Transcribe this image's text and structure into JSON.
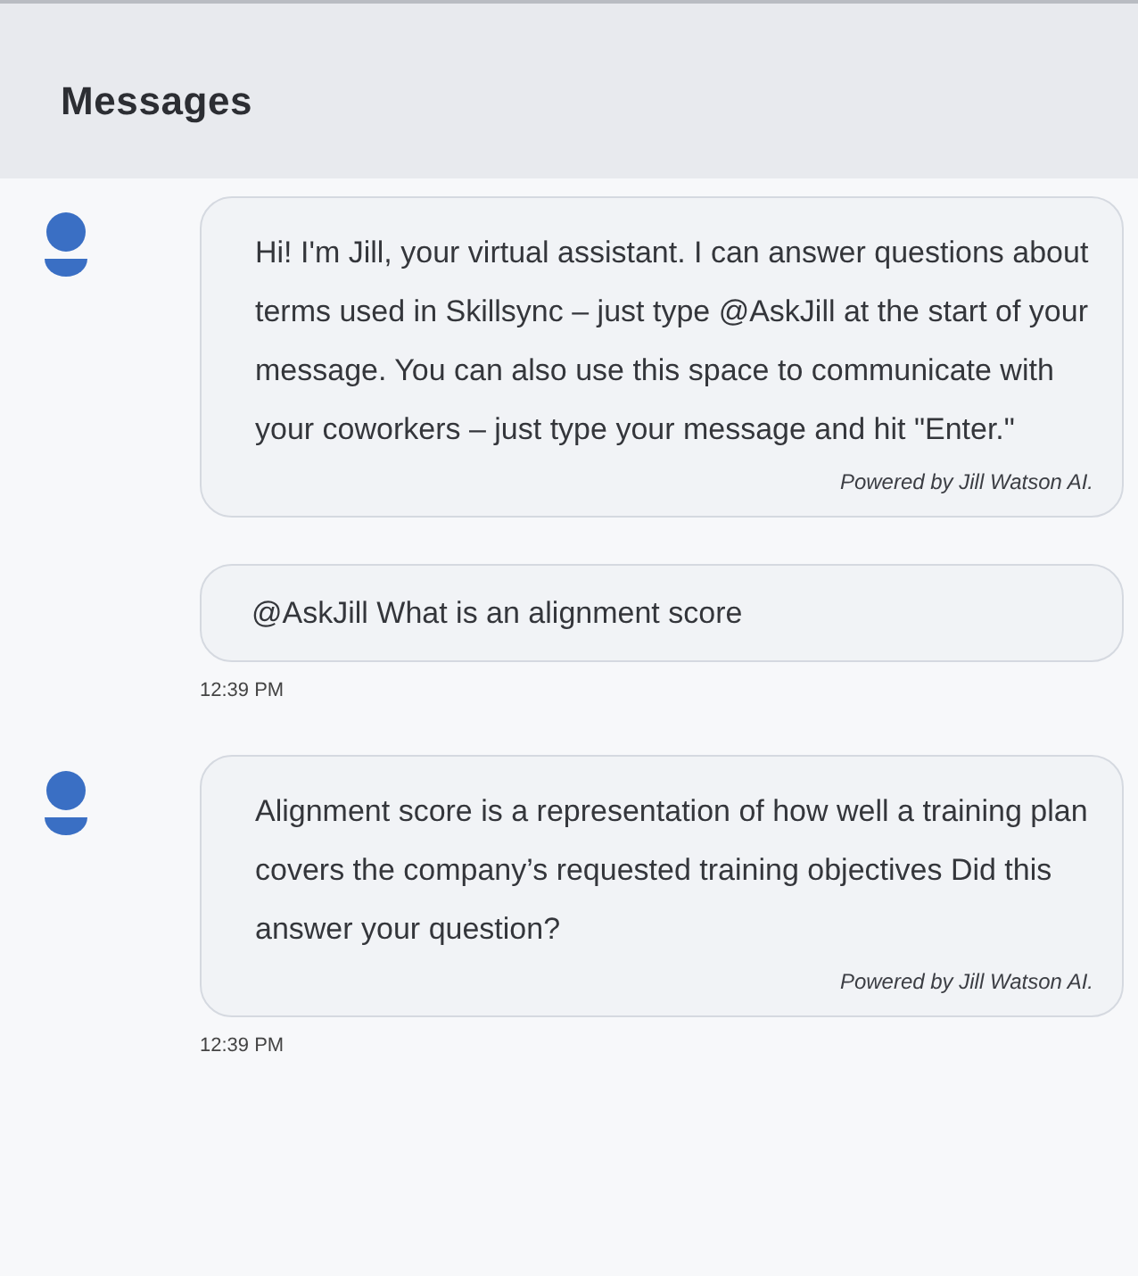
{
  "header": {
    "title": "Messages"
  },
  "messages": [
    {
      "kind": "bot",
      "text": "Hi! I'm Jill, your virtual assistant. I can answer questions about terms used in Skillsync – just type @AskJill at the start of your message. You can also use this space to communicate with your coworkers – just type your message and hit \"Enter.\"",
      "footer": "Powered by Jill Watson AI."
    },
    {
      "kind": "user",
      "text": "@AskJill What is an alignment score",
      "time": "12:39 PM"
    },
    {
      "kind": "bot",
      "text": "Alignment score is a representation of how well a training plan covers the company’s requested training objectives Did this answer your question?",
      "footer": "Powered by Jill Watson AI.",
      "time": "12:39 PM"
    }
  ]
}
